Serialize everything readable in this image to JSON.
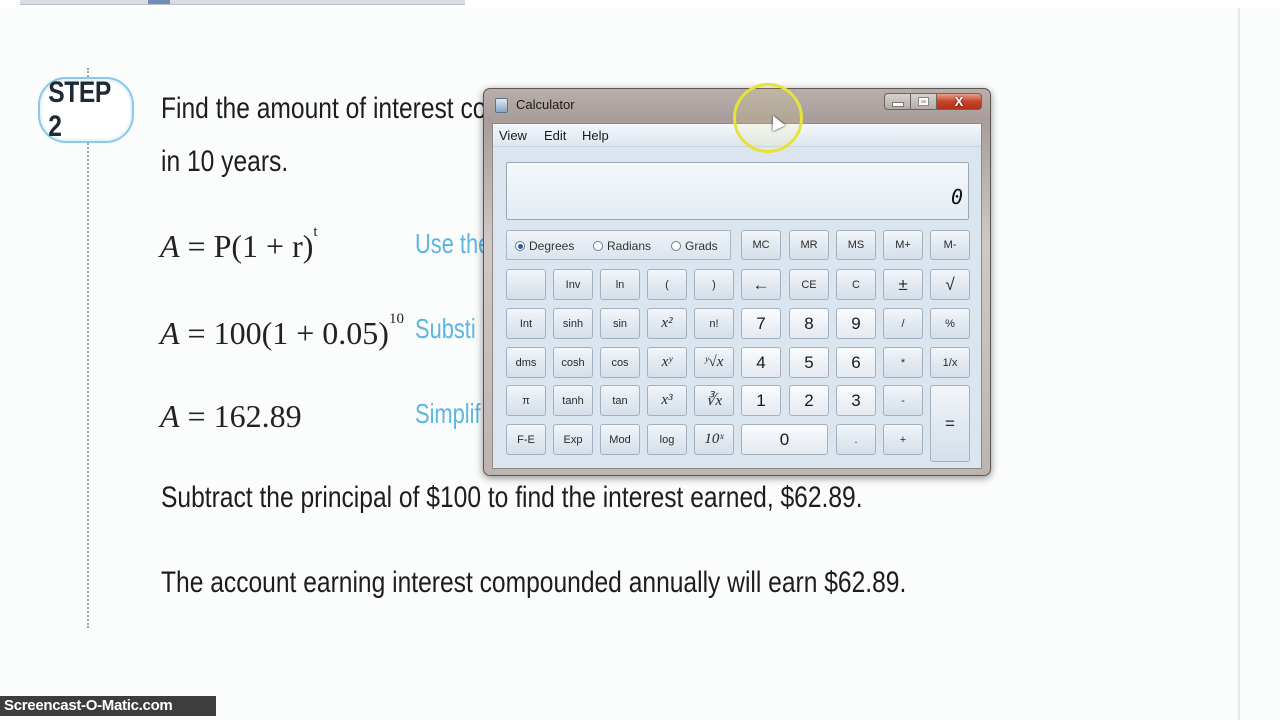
{
  "lesson": {
    "step_label": "STEP 2",
    "line1": "Find the amount of interest co",
    "line2": "in 10 years.",
    "eq1": {
      "lhs": "A",
      "rhs": "P(1 + r)",
      "exp": "t",
      "note": "Use the"
    },
    "eq2": {
      "lhs": "A",
      "rhs": "100(1 + 0.05)",
      "exp": "10",
      "note": "Substi"
    },
    "eq3": {
      "lhs": "A",
      "rhs": "162.89",
      "note": "Simplif"
    },
    "para1": "Subtract the principal of $100 to find the interest earned, $62.89.",
    "para2": "The account earning interest compounded annually will earn $62.89."
  },
  "watermark": "Screencast-O-Matic.com",
  "calculator": {
    "title": "Calculator",
    "window_buttons": {
      "close": "X"
    },
    "menu": [
      "View",
      "Edit",
      "Help"
    ],
    "display_value": "0",
    "angle_modes": [
      {
        "label": "Degrees",
        "selected": true
      },
      {
        "label": "Radians",
        "selected": false
      },
      {
        "label": "Grads",
        "selected": false
      }
    ],
    "memory_keys": [
      "MC",
      "MR",
      "MS",
      "M+",
      "M-"
    ],
    "rows": [
      [
        "",
        "Inv",
        "ln",
        "(",
        ")",
        "←",
        "CE",
        "C",
        "±",
        "√"
      ],
      [
        "Int",
        "sinh",
        "sin",
        "x²",
        "n!",
        "7",
        "8",
        "9",
        "/",
        "%"
      ],
      [
        "dms",
        "cosh",
        "cos",
        "xʸ",
        "ʸ√x",
        "4",
        "5",
        "6",
        "*",
        "1/x"
      ],
      [
        "π",
        "tanh",
        "tan",
        "x³",
        "∛x",
        "1",
        "2",
        "3",
        "-",
        "="
      ],
      [
        "F-E",
        "Exp",
        "Mod",
        "log",
        "10ˣ",
        "0",
        ".",
        "+"
      ]
    ]
  },
  "colors": {
    "accent_note": "#5cb6df",
    "badge_border": "#8ac8ea",
    "cursor_highlight": "#e6e23a"
  }
}
